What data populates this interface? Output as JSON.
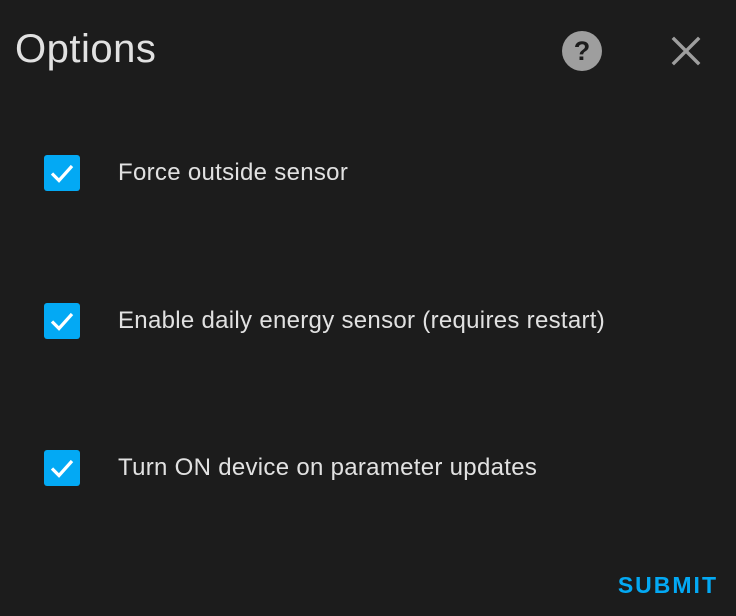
{
  "dialog": {
    "title": "Options",
    "help_icon": "help-circle-icon",
    "close_icon": "close-icon"
  },
  "options": [
    {
      "label": "Force outside sensor",
      "checked": true
    },
    {
      "label": "Enable daily energy sensor (requires restart)",
      "checked": true
    },
    {
      "label": "Turn ON device on parameter updates",
      "checked": true
    }
  ],
  "footer": {
    "submit_label": "SUBMIT"
  },
  "colors": {
    "background": "#1c1c1c",
    "accent": "#03a9f4",
    "text": "#e1e1e1",
    "icon": "#9e9e9e"
  }
}
